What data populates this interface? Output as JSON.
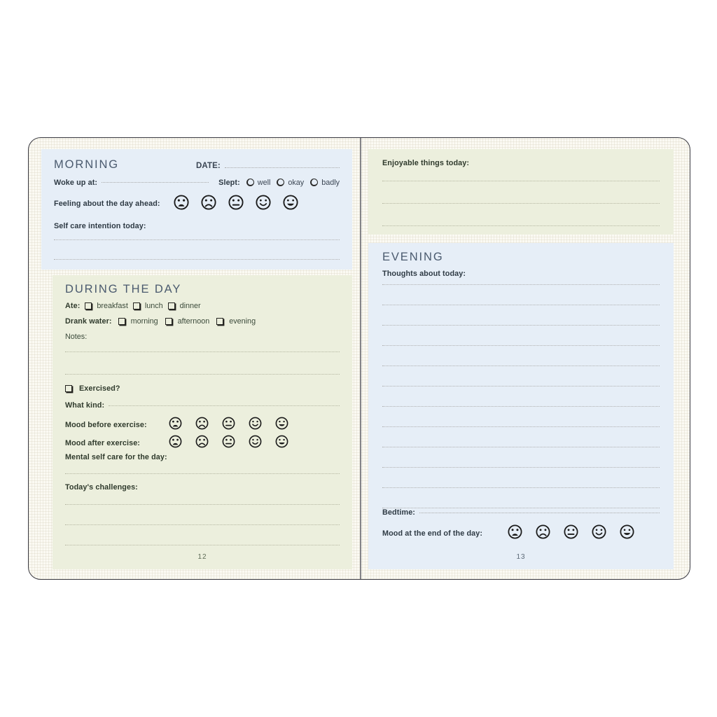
{
  "document": {
    "type": "wellbeing-journal-spread",
    "left_page_number": "12",
    "right_page_number": "13"
  },
  "colors": {
    "panel_blue": "#e6eef7",
    "panel_green": "#ecefdd",
    "paper": "#fbfaf3",
    "heading": "#4a5a6e",
    "ink": "#2e3a44",
    "rule": "#b0b0b0"
  },
  "morning": {
    "heading": "MORNING",
    "date_label": "DATE:",
    "woke_label": "Woke up at:",
    "slept_label": "Slept:",
    "slept_options": [
      "well",
      "okay",
      "badly"
    ],
    "feeling_label": "Feeling about the day ahead:",
    "self_care_label": "Self care intention today:",
    "mood_scale": [
      "very-sad-face",
      "sad-face",
      "neutral-face",
      "happy-face",
      "very-happy-face"
    ],
    "writing_lines": 2
  },
  "during_the_day": {
    "heading": "DURING THE DAY",
    "ate_label": "Ate:",
    "ate_options": [
      "breakfast",
      "lunch",
      "dinner"
    ],
    "water_label": "Drank water:",
    "water_options": [
      "morning",
      "afternoon",
      "evening"
    ],
    "notes_label": "Notes:",
    "notes_lines": 2,
    "exercised_label": "Exercised?",
    "what_kind_label": "What kind:",
    "mood_before_label": "Mood before exercise:",
    "mood_after_label": "Mood after exercise:",
    "mental_self_care_label": "Mental self care for the day:",
    "mental_self_care_lines": 1,
    "challenges_label": "Today's challenges:",
    "challenges_lines": 3,
    "mood_scale": [
      "very-sad-face",
      "sad-face",
      "neutral-face",
      "happy-face",
      "very-happy-face"
    ]
  },
  "enjoyable": {
    "label": "Enjoyable things today:",
    "writing_lines": 3
  },
  "evening": {
    "heading": "EVENING",
    "thoughts_label": "Thoughts about today:",
    "thoughts_lines": 12,
    "bedtime_label": "Bedtime:",
    "end_mood_label": "Mood at the end of the day:",
    "mood_scale": [
      "very-sad-face",
      "sad-face",
      "neutral-face",
      "happy-face",
      "very-happy-face"
    ]
  }
}
